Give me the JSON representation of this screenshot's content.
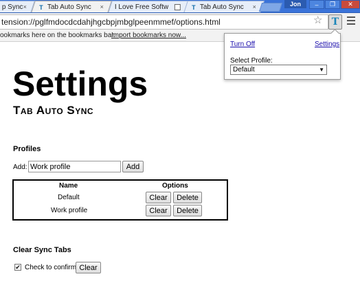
{
  "browser": {
    "tabs": [
      {
        "label": "p Sync",
        "icon": "page-icon"
      },
      {
        "label": "Tab Auto Sync",
        "icon": "tab-auto-sync-icon"
      },
      {
        "label": "I Love Free Softw",
        "icon": "blank-page-icon"
      },
      {
        "label": "Tab Auto Sync",
        "icon": "tab-auto-sync-icon"
      }
    ],
    "close_glyph": "×",
    "profile_name": "Jon",
    "window_buttons": {
      "minimize": "–",
      "restore": "❐",
      "close": "✕"
    },
    "address": "tension://pglfmdocdcdahjhgcbpjmbglpeenmmef/options.html",
    "bookmarks_hint": "ookmarks here on the bookmarks bar.",
    "import_link": "Import bookmarks now...",
    "extension_icon_letter": "T"
  },
  "popup": {
    "turn_off": "Turn Off",
    "settings": "Settings",
    "select_profile_label": "Select Profile:",
    "selected_profile": "Default"
  },
  "page": {
    "title": "Settings",
    "subtitle": "Tab Auto Sync",
    "profiles_heading": "Profiles",
    "add_label": "Add:",
    "add_input_value": "Work profile",
    "add_button": "Add",
    "table": {
      "headers": {
        "name": "Name",
        "options": "Options"
      },
      "rows": [
        {
          "name": "Default",
          "clear": "Clear",
          "delete": "Delete"
        },
        {
          "name": "Work profile",
          "clear": "Clear",
          "delete": "Delete"
        }
      ]
    },
    "clear_heading": "Clear Sync Tabs",
    "confirm_label": "Check to confirm",
    "confirm_checked": true,
    "confirm_mark": "✔",
    "clear_button": "Clear"
  },
  "colors": {
    "tabstrip": "#3a73d9",
    "link": "#1a0dab",
    "extension_icon": "#1b86b9"
  }
}
